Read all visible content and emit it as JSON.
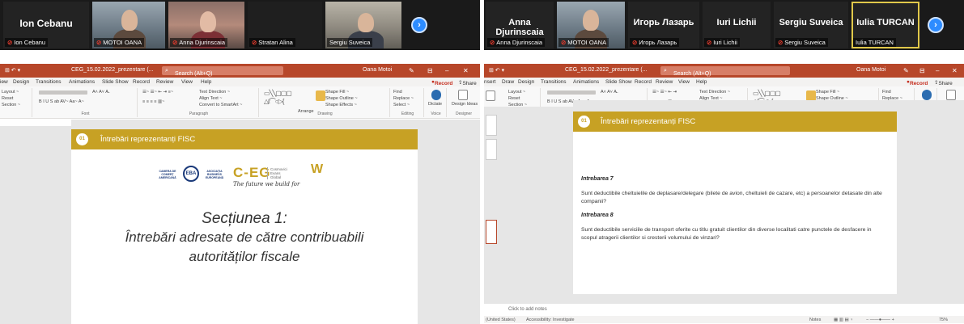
{
  "left": {
    "participants": [
      {
        "big_name": "Ion Cebanu",
        "label": "Ion Cebanu",
        "muted": true
      },
      {
        "big_name": "",
        "label": "MOTOI OANA",
        "muted": true
      },
      {
        "big_name": "",
        "label": "Anna Djurinscaia",
        "muted": true
      },
      {
        "big_name": "",
        "label": "Stratan Alina",
        "muted": true
      },
      {
        "big_name": "",
        "label": "Sergiu Suveica",
        "muted": false
      }
    ],
    "ppt": {
      "doc_name": "CEG_15.02.2022_prezentare (...",
      "search": "Search (Alt+Q)",
      "user": "Oana Motoi"
    },
    "menu": [
      "iew",
      "Design",
      "Transitions",
      "Animations",
      "Slide Show",
      "Record",
      "Review",
      "View",
      "Help"
    ],
    "ribbon": {
      "slides": [
        "Layout ~",
        "Reset",
        "Section ~"
      ],
      "groups": [
        "Font",
        "Paragraph",
        "Drawing",
        "Editing",
        "Voice",
        "Designer"
      ],
      "paragraph_items": [
        "Text Direction ~",
        "Align Text ~",
        "Convert to SmartArt ~"
      ],
      "drawing_items": [
        "Shape Fill ~",
        "Shape Outline ~",
        "Shape Effects ~"
      ],
      "arrange": "Arrange",
      "quick_styles": "Quick Styles",
      "editing_items": [
        "Find",
        "Replace ~",
        "Select ~"
      ],
      "dictate": "Dictate",
      "design_ideas": "Design Ideas",
      "record": "Record",
      "share": "Share"
    },
    "slide": {
      "number": "01",
      "header": "Întrebări reprezentanți FISC",
      "logo_eba": "EBA",
      "logo_left": "CAMERA DE COMERȚ AMERICANĂ",
      "logo_right": "ASOCIAȚIA BUSINESS EUROPEANĂ",
      "cfg": "C-EG",
      "cfg_side": "Cosmovici Evans Global",
      "tagline": "The future we build for",
      "title_line1": "Secțiunea 1:",
      "title_line2": "Întrebări adresate de către contribuabili",
      "title_line3": "autorităților fiscale"
    }
  },
  "right": {
    "participants": [
      {
        "big_name": "Anna Djurinscaia",
        "label": "Anna Djurinscaia",
        "muted": true
      },
      {
        "big_name": "",
        "label": "MOTOI OANA",
        "muted": true
      },
      {
        "big_name": "Игорь Лазарь",
        "label": "Игорь Лазарь",
        "muted": true
      },
      {
        "big_name": "Iuri Lichii",
        "label": "Iuri Lichii",
        "muted": true
      },
      {
        "big_name": "Sergiu Suveica",
        "label": "Sergiu Suveica",
        "muted": true
      },
      {
        "big_name": "Iulia TURCAN",
        "label": "Iulia TURCAN",
        "muted": false
      }
    ],
    "ppt": {
      "doc_name": "CEG_15.02.2022_prezentare (...",
      "search": "Search (Alt+Q)",
      "user": "Oana Motoi"
    },
    "menu": [
      "nsert",
      "Draw",
      "Design",
      "Transitions",
      "Animations",
      "Slide Show",
      "Record",
      "Review",
      "View",
      "Help"
    ],
    "slide": {
      "number": "01",
      "header": "Întrebări reprezentanți FISC",
      "q7_label": "Intrebarea 7",
      "q7_text": "Sunt deductibile cheltuielile de deplasare/delegare (bilete de avion, cheltuieli de cazare, etc) a persoanelor detasate din alte companii?",
      "q8_label": "Intrebarea 8",
      "q8_text": "Sunt deductibile serviciile de transport oferite cu titlu gratuit clientilor din diverse localitati catre punctele de desfacere in scopul atragerii clientilor si cresterii volumului de vinzari?"
    },
    "notes": "Click to add notes",
    "status": {
      "language": "(United States)",
      "accessibility": "Accessibility: Investigate",
      "notes_btn": "Notes",
      "zoom": "75%"
    }
  }
}
